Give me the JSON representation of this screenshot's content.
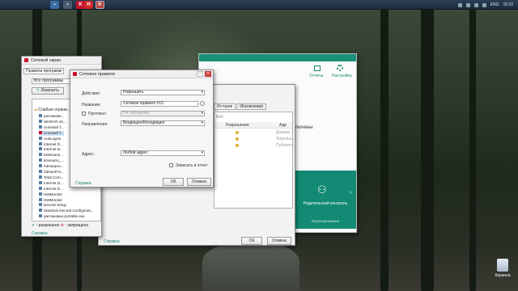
{
  "taskbar": {
    "apps": [
      {
        "name": "app-1",
        "color": "#3a6ea5",
        "glyph": "▪"
      },
      {
        "name": "app-2",
        "color": "#4b5d72",
        "glyph": "▪"
      },
      {
        "name": "app-3",
        "color": "#c8102e",
        "glyph": "K"
      },
      {
        "name": "app-4",
        "color": "#d02a2a",
        "glyph": "H"
      },
      {
        "name": "app-5",
        "color": "#b9473d",
        "glyph": "K"
      }
    ],
    "lang": "ENG",
    "clock": "15:22"
  },
  "main_window": {
    "reports_label": "Отчеты",
    "settings_label": "Настройка",
    "connected_text": "ключены",
    "tile_label": "Родительский контроль",
    "tile_sub": "Лицензирование"
  },
  "firewall_window": {
    "title": "Сетевой экран",
    "tab_label": "Правила программ",
    "filter_value": "Все программы",
    "edit_button": "Изменить",
    "tree_root": "Слабые ограни...",
    "tree_items": [
      "распаковк...",
      "WinRAR x6...",
      "Uninstall T...",
      "Uninstall T...",
      "AusLogics",
      "Internet D...",
      "Internet D...",
      "KMSnano...",
      "kmsnano_...",
      "hdmanpro...",
      "hdmanPro...",
      "Total Com...",
      "Internet D...",
      "Internet D...",
      "HWMonitor",
      "HWMonitor",
      "Decor8 Setup",
      "Stardock Decor8 Configurati...",
      "распаковка portable.exe"
    ],
    "legend_allowed": "- разрешено",
    "legend_denied": "- запрещено",
    "help_link": "Справка"
  },
  "rules_window": {
    "tabs": [
      "История",
      "Исключения"
    ],
    "col_allow": "Разрешение",
    "col_addr": "Адр",
    "rows": [
      "Довере...",
      "Локальн...",
      "Публичн..."
    ],
    "extra_label": "Веб",
    "help_link": "Справка",
    "ok": "ОК",
    "cancel": "Отмена"
  },
  "dialog": {
    "title": "Сетевое правило",
    "action_label": "Действие:",
    "action_value": "Разрешить",
    "name_label": "Название:",
    "name_value": "Сетевое правило #15",
    "protocol_label": "Протокол",
    "protocol_value": "Не определен",
    "direction_label": "Направление:",
    "direction_value": "Входящее/Исходящее",
    "address_label": "Адрес:",
    "address_value": "Любой адрес",
    "log_label": "Записать в отчет",
    "help_link": "Справка",
    "ok": "ОК",
    "cancel": "Отмена"
  },
  "desktop": {
    "recycle_label": "Корзина"
  },
  "colors": {
    "accent": "#1a8a6e",
    "kaspersky_red": "#c8102e"
  }
}
